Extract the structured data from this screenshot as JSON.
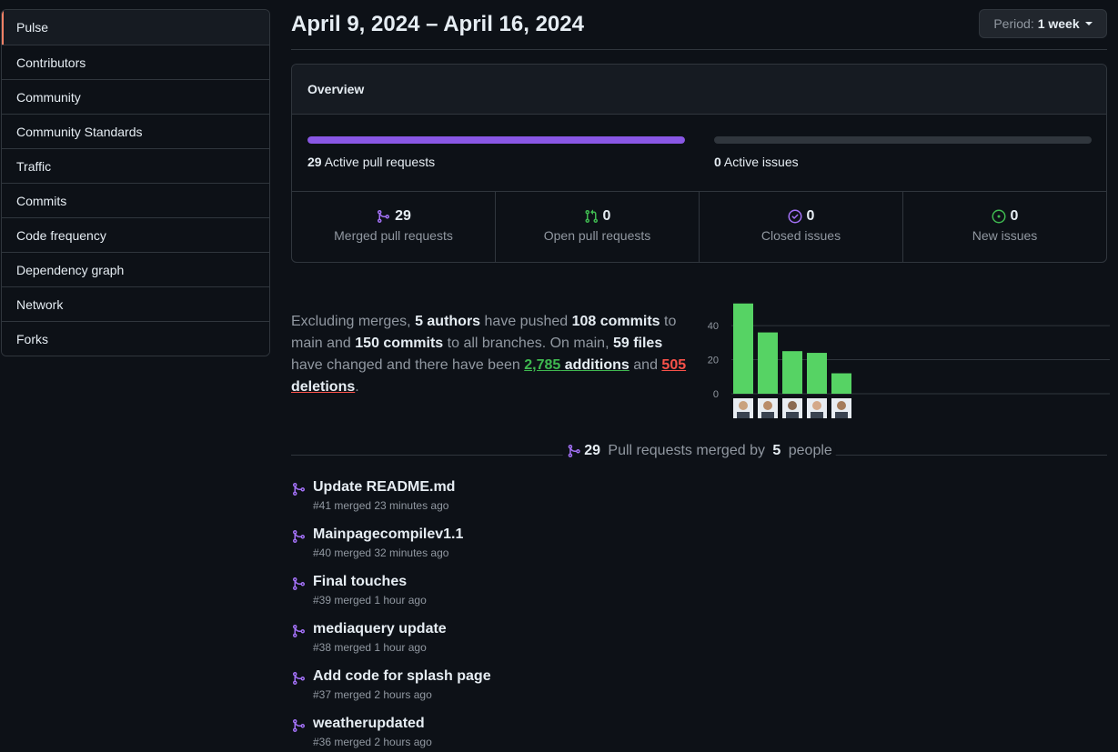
{
  "sidebar": {
    "items": [
      {
        "label": "Pulse"
      },
      {
        "label": "Contributors"
      },
      {
        "label": "Community"
      },
      {
        "label": "Community Standards"
      },
      {
        "label": "Traffic"
      },
      {
        "label": "Commits"
      },
      {
        "label": "Code frequency"
      },
      {
        "label": "Dependency graph"
      },
      {
        "label": "Network"
      },
      {
        "label": "Forks"
      }
    ]
  },
  "header": {
    "date_range": "April 9, 2024 – April 16, 2024",
    "period_label": "Period:",
    "period_value": "1 week"
  },
  "overview": {
    "title": "Overview",
    "pr_bar": {
      "count": "29",
      "label": "Active pull requests",
      "fill_fraction": 1.0,
      "color": "#8957e5"
    },
    "issue_bar": {
      "count": "0",
      "label": "Active issues",
      "fill_fraction": 0.0
    },
    "stats": [
      {
        "value": "29",
        "label": "Merged pull requests",
        "icon": "git-merge-icon",
        "color": "#a371f7"
      },
      {
        "value": "0",
        "label": "Open pull requests",
        "icon": "git-pull-request-icon",
        "color": "#3fb950"
      },
      {
        "value": "0",
        "label": "Closed issues",
        "icon": "issue-closed-icon",
        "color": "#a371f7"
      },
      {
        "value": "0",
        "label": "New issues",
        "icon": "issue-opened-icon",
        "color": "#3fb950"
      }
    ]
  },
  "summary": {
    "t1": "Excluding merges, ",
    "authors": "5 authors",
    "t2": " have pushed ",
    "main_commits": "108 commits",
    "t3": " to main and ",
    "all_commits": "150 commits",
    "t4": " to all branches. On main, ",
    "files": "59 files",
    "t5": " have changed and there have been ",
    "additions_num": "2,785",
    "additions_word": " additions",
    "t6": " and ",
    "deletions_num": "505",
    "deletions_word": " deletions",
    "t7": "."
  },
  "chart_data": {
    "type": "bar",
    "categories": [
      "author-1",
      "author-2",
      "author-3",
      "author-4",
      "author-5"
    ],
    "values": [
      53,
      36,
      25,
      24,
      12
    ],
    "y_ticks": [
      "0",
      "20",
      "40"
    ],
    "ylim": [
      0,
      55
    ],
    "grid": true,
    "color": "#56d364"
  },
  "pr_section": {
    "count": "29",
    "text_mid": " Pull requests merged by ",
    "people_count": "5",
    "text_end": " people",
    "items": [
      {
        "title": "Update README.md",
        "meta": "#41 merged 23 minutes ago"
      },
      {
        "title": "Mainpagecompilev1.1",
        "meta": "#40 merged 32 minutes ago"
      },
      {
        "title": "Final touches",
        "meta": "#39 merged 1 hour ago"
      },
      {
        "title": "mediaquery update",
        "meta": "#38 merged 1 hour ago"
      },
      {
        "title": "Add code for splash page",
        "meta": "#37 merged 2 hours ago"
      },
      {
        "title": "weatherupdated",
        "meta": "#36 merged 2 hours ago"
      }
    ]
  }
}
